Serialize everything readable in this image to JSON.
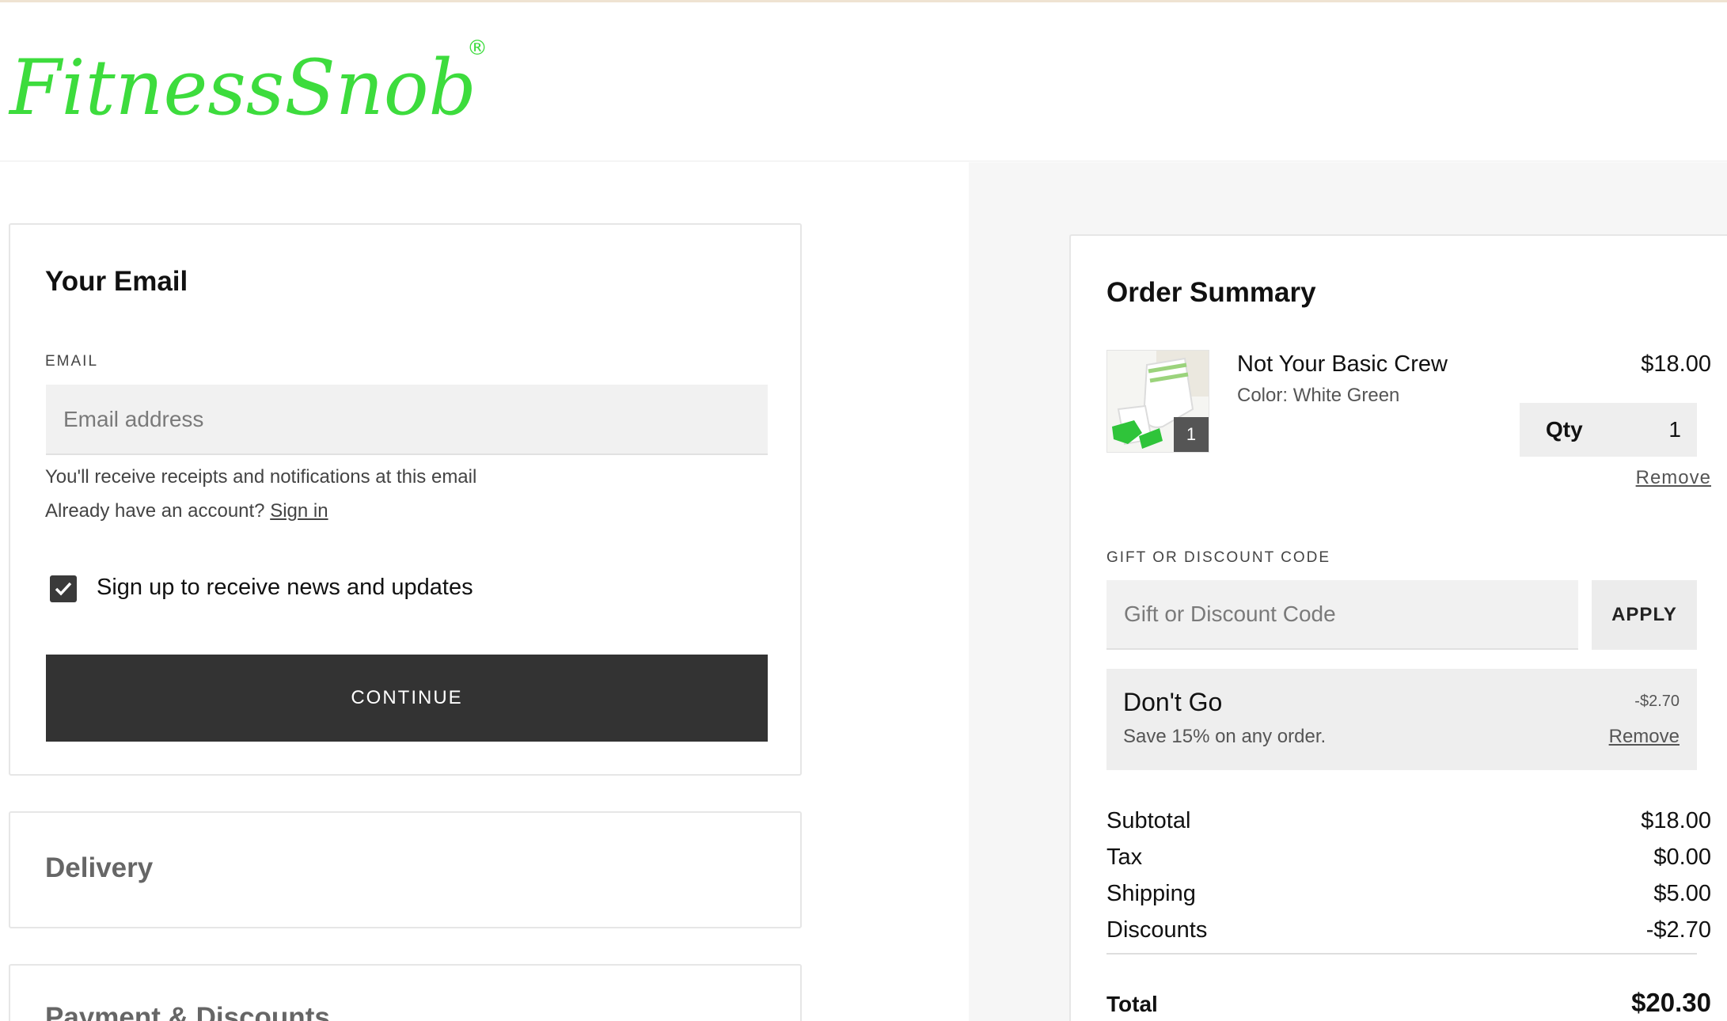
{
  "brand": {
    "logo_text": "FitnessSnob",
    "logo_mark": "®",
    "color": "#3ddc3d"
  },
  "email_section": {
    "title": "Your Email",
    "email_label": "EMAIL",
    "email_placeholder": "Email address",
    "email_value": "",
    "receipt_note": "You'll receive receipts and notifications at this email",
    "account_prompt": "Already have an account?",
    "sign_in_link": "Sign in",
    "newsletter_label": "Sign up to receive news and updates",
    "newsletter_checked": true,
    "continue_label": "CONTINUE"
  },
  "delivery_section": {
    "title": "Delivery"
  },
  "payment_section": {
    "title": "Payment & Discounts"
  },
  "order_summary": {
    "title": "Order Summary",
    "item": {
      "name": "Not Your Basic Crew",
      "variant": "Color: White Green",
      "price": "$18.00",
      "qty_label": "Qty",
      "qty_value": "1",
      "badge_count": "1",
      "remove_label": "Remove"
    },
    "discount_code": {
      "label": "GIFT OR DISCOUNT CODE",
      "placeholder": "Gift or Discount Code",
      "apply_label": "APPLY"
    },
    "applied_discount": {
      "name": "Don't Go",
      "description": "Save 15% on any order.",
      "amount": "-$2.70",
      "remove_label": "Remove"
    },
    "totals": {
      "subtotal_label": "Subtotal",
      "subtotal_value": "$18.00",
      "tax_label": "Tax",
      "tax_value": "$0.00",
      "shipping_label": "Shipping",
      "shipping_value": "$5.00",
      "discounts_label": "Discounts",
      "discounts_value": "-$2.70",
      "total_label": "Total",
      "total_value": "$20.30"
    }
  }
}
